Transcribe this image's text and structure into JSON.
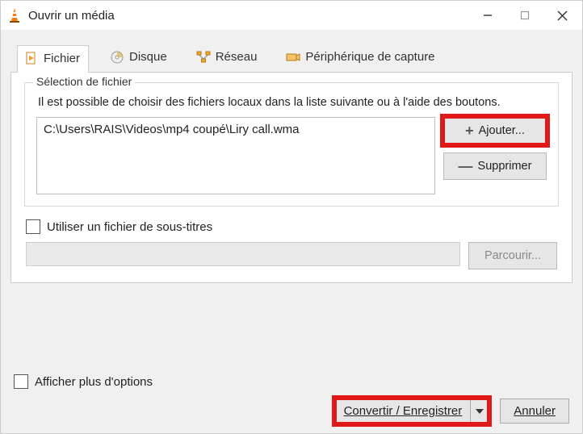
{
  "window": {
    "title": "Ouvrir un média"
  },
  "tabs": {
    "file": {
      "label": "Fichier"
    },
    "disc": {
      "label": "Disque"
    },
    "network": {
      "label": "Réseau"
    },
    "capture": {
      "label": "Périphérique de capture"
    }
  },
  "file_section": {
    "legend": "Sélection de fichier",
    "hint": "Il est possible de choisir des fichiers locaux dans la liste suivante ou à l'aide des boutons.",
    "selected_file": "C:\\Users\\RAIS\\Videos\\mp4 coupé\\Liry call.wma",
    "add_label": "Ajouter...",
    "remove_label": "Supprimer"
  },
  "subtitle": {
    "checkbox_label": "Utiliser un fichier de sous-titres",
    "browse_label": "Parcourir..."
  },
  "footer": {
    "more_options_label": "Afficher plus d'options",
    "convert_label": "Convertir / Enregistrer",
    "cancel_label_first": "A",
    "cancel_label_rest": "nnuler"
  }
}
